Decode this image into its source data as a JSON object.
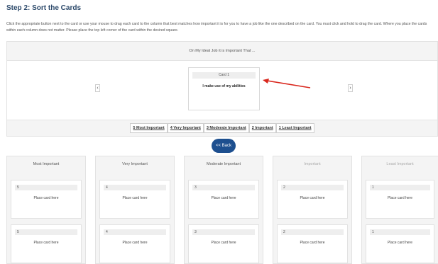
{
  "page": {
    "title": "Step 2: Sort the Cards",
    "instructions": "Click the appropriate button next to the card or use your mouse to drag each card to the column that best matches how important it is for you to have a job like the one described on the card. You must click and hold to drag the card. Where you place the cards within each column does not matter. Please place the top left corner of the card within the desired square."
  },
  "sort_panel": {
    "prompt": "On My Ideal Job it is Important That ...",
    "card": {
      "label": "Card 1",
      "text": "I make use of my abilities"
    },
    "prev_glyph": "‹",
    "next_glyph": "›",
    "rating_buttons": [
      "5 Most Important",
      "4 Very Important",
      "3 Moderate Important",
      "2 Important",
      "1 Least Important"
    ],
    "accent_arrow_color": "#d9261c"
  },
  "back_button": "<< Back",
  "columns": [
    {
      "header": "Most Important",
      "slot_number": "5",
      "placeholder": "Place card here"
    },
    {
      "header": "Very Important",
      "slot_number": "4",
      "placeholder": "Place card here"
    },
    {
      "header": "Moderate Important",
      "slot_number": "3",
      "placeholder": "Place card here"
    },
    {
      "header": "Important",
      "slot_number": "2",
      "placeholder": "Place card here"
    },
    {
      "header": "Least Important",
      "slot_number": "1",
      "placeholder": "Place card here"
    }
  ],
  "colors": {
    "title": "#2d4a6b",
    "back_button": "#1d4f8f",
    "panel_bg": "#f4f4f4"
  }
}
